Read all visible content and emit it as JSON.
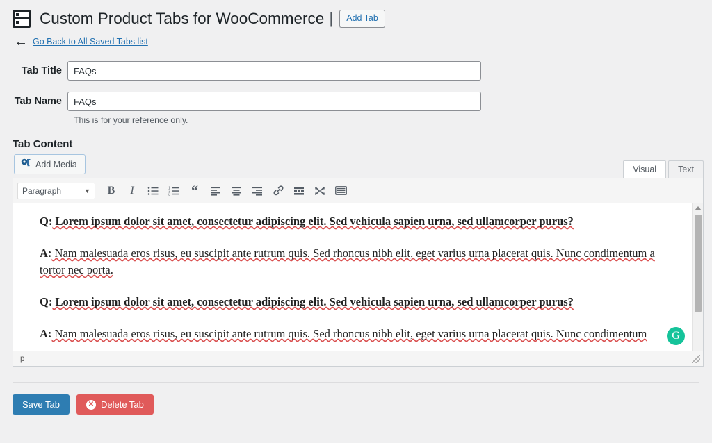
{
  "header": {
    "title": "Custom Product Tabs for WooCommerce",
    "separator": "|",
    "add_tab_label": "Add Tab",
    "brand_icon": "tabs-layout-icon"
  },
  "back_nav": {
    "arrow": "←",
    "label": "Go Back to All Saved Tabs list"
  },
  "form": {
    "tab_title": {
      "label": "Tab Title",
      "value": "FAQs",
      "placeholder": ""
    },
    "tab_name": {
      "label": "Tab Name",
      "value": "FAQs",
      "placeholder": "",
      "hint": "This is for your reference only."
    }
  },
  "tab_content": {
    "section_label": "Tab Content",
    "add_media_label": "Add Media",
    "add_media_icon": "media-camera-icon",
    "editor_tabs": [
      {
        "label": "Visual",
        "active": true
      },
      {
        "label": "Text",
        "active": false
      }
    ],
    "toolbar": {
      "format_select": {
        "value": "Paragraph",
        "caret_icon": "chevron-down-icon"
      },
      "buttons": [
        {
          "name": "bold-button",
          "icon": "bold-icon",
          "label": "B"
        },
        {
          "name": "italic-button",
          "icon": "italic-icon",
          "label": "I"
        },
        {
          "name": "bulleted-list-button",
          "icon": "bulleted-list-icon",
          "label": ""
        },
        {
          "name": "numbered-list-button",
          "icon": "numbered-list-icon",
          "label": ""
        },
        {
          "name": "blockquote-button",
          "icon": "blockquote-icon",
          "label": "“"
        },
        {
          "name": "align-left-button",
          "icon": "align-left-icon",
          "label": ""
        },
        {
          "name": "align-center-button",
          "icon": "align-center-icon",
          "label": ""
        },
        {
          "name": "align-right-button",
          "icon": "align-right-icon",
          "label": ""
        },
        {
          "name": "insert-link-button",
          "icon": "link-icon",
          "label": ""
        },
        {
          "name": "read-more-button",
          "icon": "read-more-icon",
          "label": ""
        },
        {
          "name": "fullscreen-button",
          "icon": "fullscreen-icon",
          "label": ""
        },
        {
          "name": "toolbar-toggle-button",
          "icon": "keyboard-toolbar-icon",
          "label": ""
        }
      ]
    },
    "document": {
      "paragraphs": [
        {
          "prefix": "Q:",
          "bold": true,
          "text": " Lorem ipsum dolor sit amet, consectetur adipiscing elit. Sed vehicula sapien urna, sed ullamcorper purus?"
        },
        {
          "prefix": "A:",
          "bold": false,
          "text": " Nam malesuada eros risus, eu suscipit ante rutrum quis. Sed rhoncus nibh elit, eget varius urna placerat quis. Nunc condimentum a tortor nec porta."
        },
        {
          "prefix": "Q:",
          "bold": true,
          "text": " Lorem ipsum dolor sit amet, consectetur adipiscing elit. Sed vehicula sapien urna, sed ullamcorper purus?"
        },
        {
          "prefix": "A:",
          "bold": false,
          "text": " Nam malesuada eros risus, eu suscipit ante rutrum quis. Sed rhoncus nibh elit, eget varius urna placerat quis. Nunc condimentum"
        }
      ]
    },
    "grammarly_badge": {
      "letter": "G",
      "color": "#15c39a",
      "icon": "grammarly-icon"
    },
    "statusbar": {
      "path": "p",
      "resize_handle_icon": "resize-grip-icon"
    },
    "scrollbar": {
      "up_arrow_icon": "scroll-up-arrow-icon"
    }
  },
  "footer": {
    "save_label": "Save Tab",
    "delete_label": "Delete Tab",
    "delete_icon": "x-circle-icon",
    "save_color": "#2e7db2",
    "delete_color": "#e05a5a"
  },
  "theme": {
    "background": "#f0f0f1",
    "link_color": "#2271b1",
    "text_color": "#1d2327",
    "spellcheck_underline": "#d94f4f"
  }
}
